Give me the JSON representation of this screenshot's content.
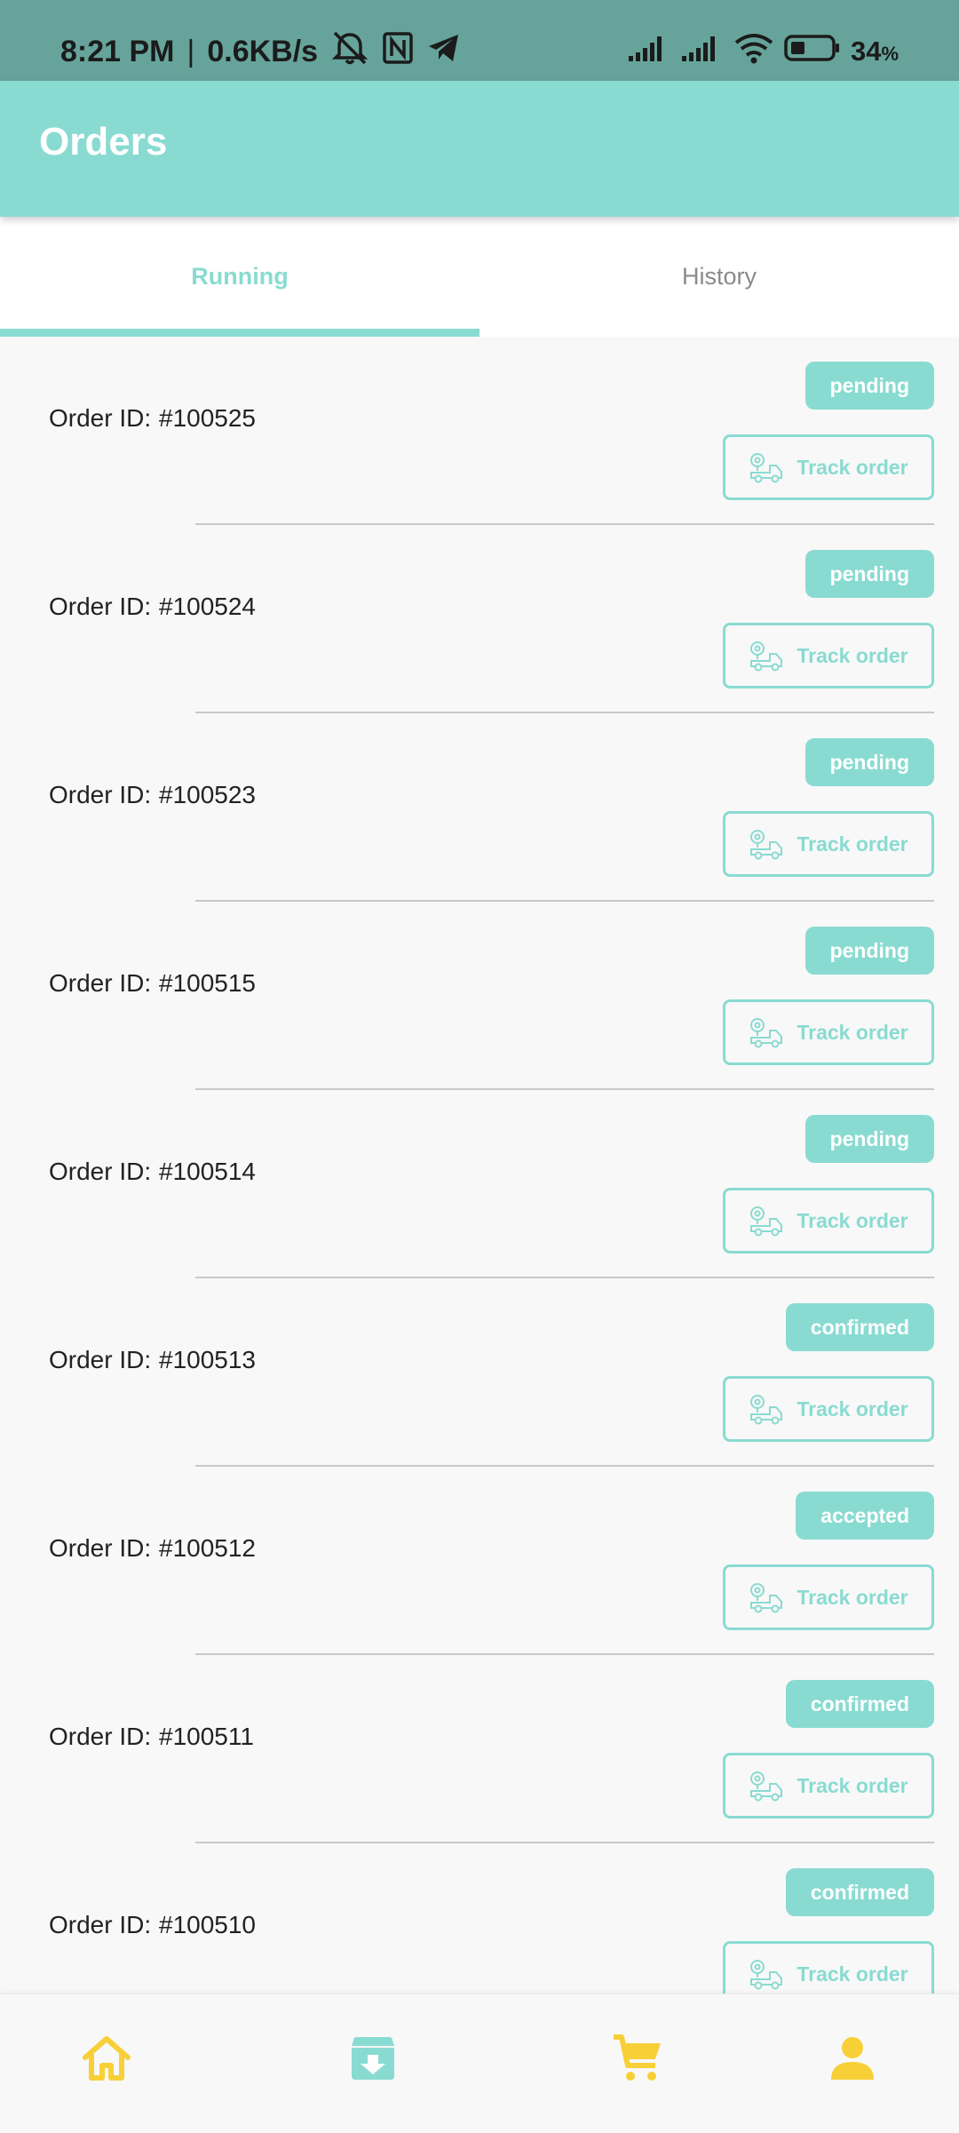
{
  "status_bar": {
    "time": "8:21 PM",
    "separator": "|",
    "network_speed": "0.6KB/s",
    "battery_percent": "34",
    "battery_suffix": "%"
  },
  "app_bar": {
    "title": "Orders"
  },
  "tabs": [
    {
      "label": "Running",
      "active": true
    },
    {
      "label": "History",
      "active": false
    }
  ],
  "order_label": "Order ID:",
  "track_label": "Track order",
  "orders": [
    {
      "id": "#100525",
      "status": "pending"
    },
    {
      "id": "#100524",
      "status": "pending"
    },
    {
      "id": "#100523",
      "status": "pending"
    },
    {
      "id": "#100515",
      "status": "pending"
    },
    {
      "id": "#100514",
      "status": "pending"
    },
    {
      "id": "#100513",
      "status": "confirmed"
    },
    {
      "id": "#100512",
      "status": "accepted"
    },
    {
      "id": "#100511",
      "status": "confirmed"
    },
    {
      "id": "#100510",
      "status": "confirmed"
    }
  ],
  "bottom_nav": [
    {
      "icon": "home-icon"
    },
    {
      "icon": "archive-download-icon"
    },
    {
      "icon": "cart-icon"
    },
    {
      "icon": "person-icon"
    }
  ],
  "colors": {
    "accent": "#89dbd1",
    "status_bar": "#66a49b",
    "nav_yellow": "#f7d038",
    "nav_teal": "#89dbd1"
  }
}
